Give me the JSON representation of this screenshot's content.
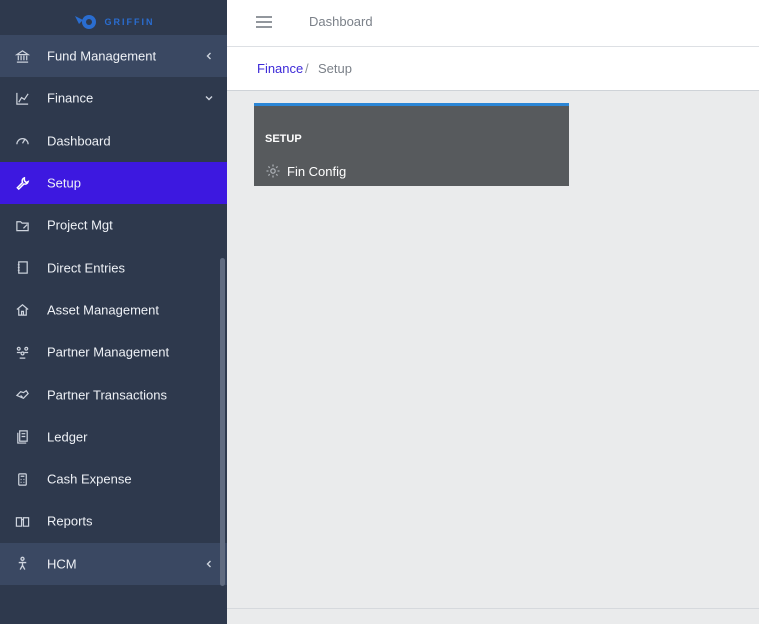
{
  "brand": {
    "logo_text": "GRIFFIN"
  },
  "topbar": {
    "title": "Dashboard",
    "menu_icon": "hamburger-icon"
  },
  "breadcrumb": {
    "items": [
      "Finance",
      "Setup"
    ],
    "separator": "/"
  },
  "sidebar": {
    "items": [
      {
        "label": "Fund Management",
        "icon": "bank-icon",
        "caret": "left",
        "state": "group"
      },
      {
        "label": "Finance",
        "icon": "chart-icon",
        "caret": "down",
        "state": "open"
      },
      {
        "label": "Dashboard",
        "icon": "gauge-icon",
        "state": "normal"
      },
      {
        "label": "Setup",
        "icon": "wrench-icon",
        "state": "active"
      },
      {
        "label": "Project Mgt",
        "icon": "folder-icon",
        "state": "normal"
      },
      {
        "label": "Direct Entries",
        "icon": "notebook-icon",
        "state": "normal"
      },
      {
        "label": "Asset Management",
        "icon": "house-icon",
        "state": "normal"
      },
      {
        "label": "Partner Management",
        "icon": "people-icon",
        "state": "normal"
      },
      {
        "label": "Partner Transactions",
        "icon": "handshake-icon",
        "state": "normal"
      },
      {
        "label": "Ledger",
        "icon": "ledger-icon",
        "state": "normal"
      },
      {
        "label": "Cash Expense",
        "icon": "calculator-icon",
        "state": "normal"
      },
      {
        "label": "Reports",
        "icon": "book-icon",
        "state": "normal"
      },
      {
        "label": "HCM",
        "icon": "person-icon",
        "caret": "left",
        "state": "group"
      }
    ]
  },
  "setup_card": {
    "title": "SETUP",
    "links": [
      {
        "label": "Fin Config",
        "icon": "gear-icon"
      }
    ]
  },
  "colors": {
    "sidebar_bg": "#2e394d",
    "sidebar_group_bg": "#3a4862",
    "active_bg": "#3d18e0",
    "card_bg": "#575a5d",
    "card_accent": "#2b86d6",
    "link": "#3d2ad8"
  }
}
